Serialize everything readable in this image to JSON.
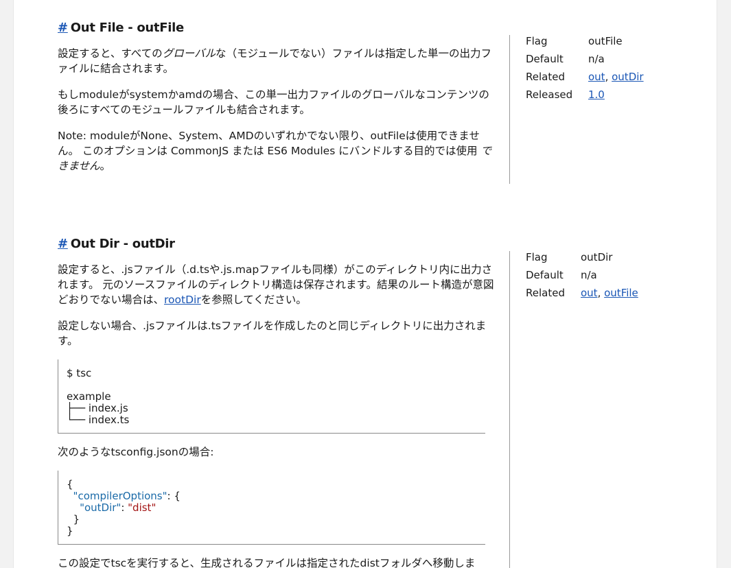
{
  "outfile": {
    "hash": "#",
    "title": "Out File - outFile",
    "p1": "設定すると、すべてのグローバルな（モジュールでない）ファイルは指定した単一の出力ファイルに結合されます。",
    "p1_a": "設定すると、すべての",
    "p1_em": "グローバル",
    "p1_b": "な（モジュールでない）ファイルは指定した単一の出力ファイルに結合されます。",
    "p2": "もしmoduleがsystemかamdの場合、この単一出力ファイルのグローバルなコンテンツの後ろにすべてのモジュールファイルも結合されます。",
    "p3_a": "Note: moduleがNone、System、AMDのいずれかでない限り、outFileは使用できません。 このオプションは CommonJS または ES6 Modules にバンドルする目的では使用",
    "p3_em": "できません",
    "p3_b": "。",
    "meta": {
      "flag_k": "Flag",
      "flag_v": "outFile",
      "default_k": "Default",
      "default_v": "n/a",
      "related_k": "Related",
      "related_1": "out",
      "related_2": "outDir",
      "released_k": "Released",
      "released_v": "1.0"
    }
  },
  "outdir": {
    "hash": "#",
    "title": "Out Dir - outDir",
    "p1_a": "設定すると、.jsファイル（.d.tsや.js.mapファイルも同様）がこのディレクトリ内に出力されます。 元のソースファイルのディレクトリ構造は保存されます。結果のルート構造が意図どおりでない場合は、",
    "p1_link": "rootDir",
    "p1_b": "を参照してください。",
    "p2": "設定しない場合、.jsファイルは.tsファイルを作成したのと同じディレクトリに出力されます。",
    "code1": {
      "cmd": "$ tsc",
      "l1": "example",
      "l2": "├── index.js",
      "l3": "└── index.ts"
    },
    "p3": "次のようなtsconfig.jsonの場合:",
    "code2": {
      "open": "{",
      "key1": "\"compilerOptions\"",
      "after1": ": {",
      "key2": "\"outDir\"",
      "colon": ": ",
      "val2": "\"dist\"",
      "close1": "}",
      "close2": "}"
    },
    "p4": "この設定でtscを実行すると、生成されるファイルは指定されたdistフォルダへ移動しま",
    "meta": {
      "flag_k": "Flag",
      "flag_v": "outDir",
      "default_k": "Default",
      "default_v": "n/a",
      "related_k": "Related",
      "related_1": "out",
      "related_2": "outFile"
    }
  }
}
